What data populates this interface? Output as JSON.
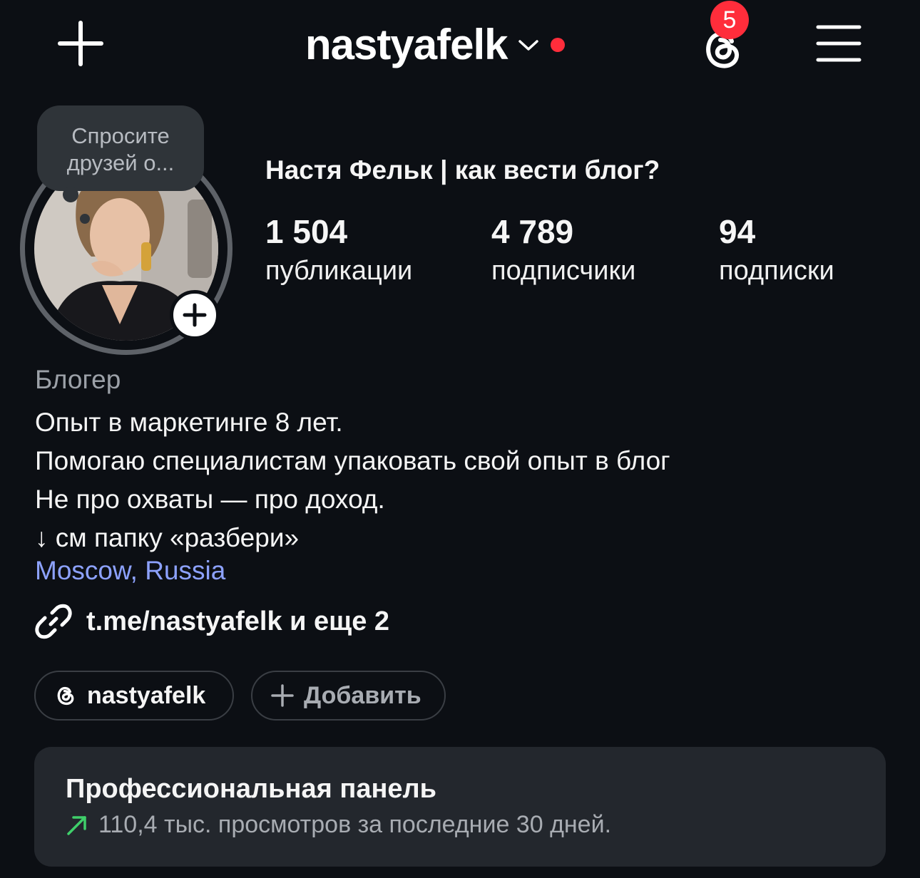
{
  "header": {
    "username": "nastyafelk",
    "notification_count": "5",
    "accent_red": "#ff2d3b"
  },
  "icons": {
    "create": "plus-icon",
    "account_switch": "chevron-down-icon",
    "threads": "threads-icon",
    "menu": "hamburger-menu-icon",
    "link": "link-icon",
    "trend": "arrow-up-right-icon"
  },
  "profile": {
    "note_bubble": "Спросите друзей о...",
    "display_name": "Настя Фельк | как вести блог?",
    "stats": [
      {
        "value": "1 504",
        "label": "публикации"
      },
      {
        "value": "4 789",
        "label": "подписчики"
      },
      {
        "value": "94",
        "label": "подписки"
      }
    ],
    "category": "Блогер",
    "bio_lines": [
      "Опыт в маркетинге 8 лет.",
      "Помогаю специалистам упаковать свой опыт в блог",
      "Не про охваты — про доход.",
      "↓ см папку «разбери»"
    ],
    "location": "Moscow, Russia",
    "link": "t.me/nastyafelk и еще 2",
    "chips": {
      "threads": "nastyafelk",
      "add": "Добавить"
    }
  },
  "pro_panel": {
    "title": "Профессиональная панель",
    "subtitle": "110,4 тыс. просмотров за последние 30 дней.",
    "trend_color": "#3fcf6a"
  },
  "colors": {
    "background": "#0c0f14",
    "link_blue": "#8da2ff",
    "panel": "#23272d"
  }
}
